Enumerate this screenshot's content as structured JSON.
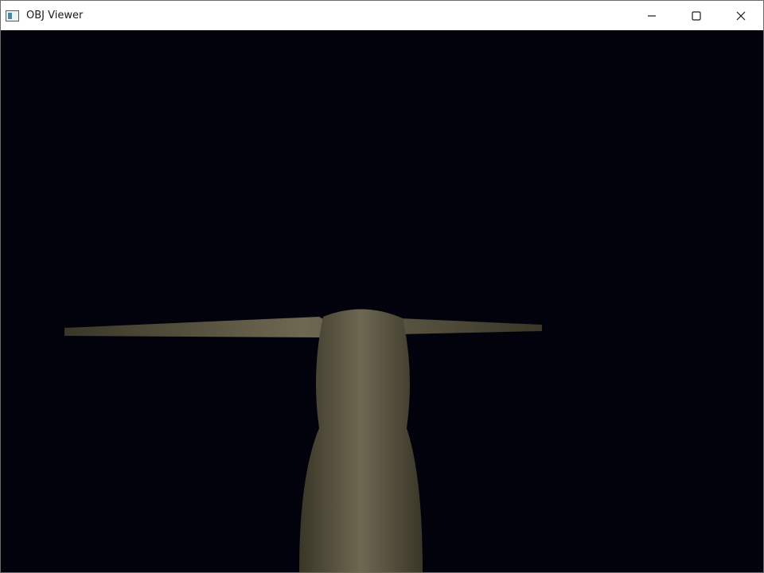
{
  "window": {
    "title": "OBJ Viewer",
    "controls": {
      "minimize_icon": "minimize-icon",
      "maximize_icon": "maximize-icon",
      "close_icon": "close-icon"
    }
  },
  "viewport": {
    "background_color": "#02020c",
    "model_color": "#6e6852"
  }
}
